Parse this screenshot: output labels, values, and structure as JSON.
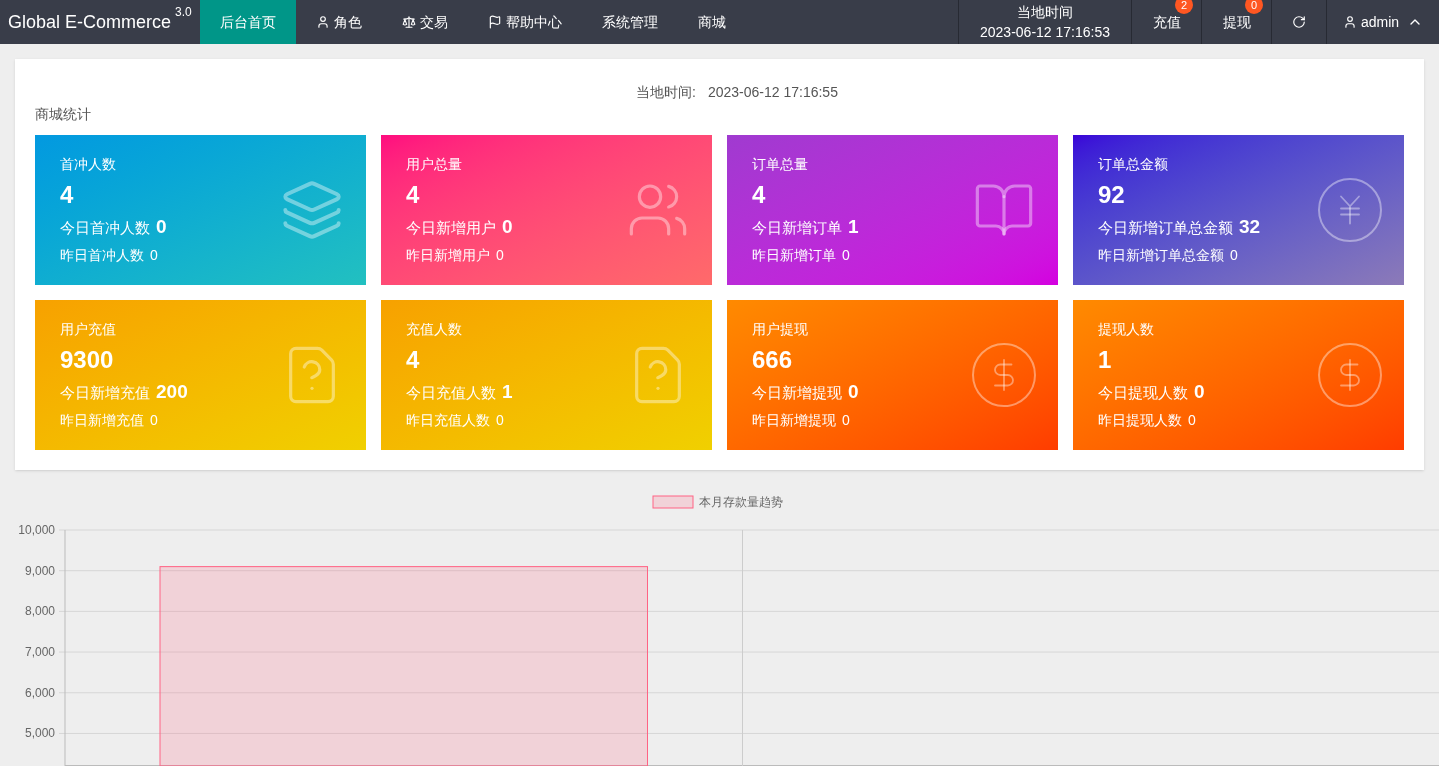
{
  "brand": {
    "name": "Global E-Commerce",
    "version": "3.0"
  },
  "nav": [
    {
      "label": "后台首页",
      "selected": true
    },
    {
      "label": "角色",
      "selected": false
    },
    {
      "label": "交易",
      "selected": false
    },
    {
      "label": "帮助中心",
      "selected": false
    },
    {
      "label": "系统管理",
      "selected": false
    },
    {
      "label": "商城",
      "selected": false
    }
  ],
  "header_clock": {
    "label": "当地时间",
    "time": "2023-06-12 17:16:53"
  },
  "header_actions": [
    {
      "label": "充值",
      "badge": "2"
    },
    {
      "label": "提现",
      "badge": "0"
    }
  ],
  "user": {
    "name": "admin"
  },
  "panel": {
    "local_time_label": "当地时间:",
    "local_time": "2023-06-12 17:16:55",
    "title": "商城统计"
  },
  "cards": [
    {
      "title": "首冲人数",
      "value": "4",
      "today_label": "今日首冲人数",
      "today": "0",
      "yesterday_label": "昨日首冲人数",
      "yesterday": "0",
      "color": "#0aa3df"
    },
    {
      "title": "用户总量",
      "value": "4",
      "today_label": "今日新增用户",
      "today": "0",
      "yesterday_label": "昨日新增用户",
      "yesterday": "0",
      "color": "#ff0a86"
    },
    {
      "title": "订单总量",
      "value": "4",
      "today_label": "今日新增订单",
      "today": "1",
      "yesterday_label": "昨日新增订单",
      "yesterday": "0",
      "color": "#b61fd6"
    },
    {
      "title": "订单总金额",
      "value": "92",
      "today_label": "今日新增订单总金额",
      "today": "32",
      "yesterday_label": "昨日新增订单总金额",
      "yesterday": "0",
      "color": "#4a0fd6"
    },
    {
      "title": "用户充值",
      "value": "9300",
      "today_label": "今日新增充值",
      "today": "200",
      "yesterday_label": "昨日新增充值",
      "yesterday": "0",
      "color": "#f5a800"
    },
    {
      "title": "充值人数",
      "value": "4",
      "today_label": "今日充值人数",
      "today": "1",
      "yesterday_label": "昨日充值人数",
      "yesterday": "0",
      "color": "#f5a800"
    },
    {
      "title": "用户提现",
      "value": "666",
      "today_label": "今日新增提现",
      "today": "0",
      "yesterday_label": "昨日新增提现",
      "yesterday": "0",
      "color": "#ff5a0a"
    },
    {
      "title": "提现人数",
      "value": "1",
      "today_label": "今日提现人数",
      "today": "0",
      "yesterday_label": "昨日提现人数",
      "yesterday": "0",
      "color": "#ff5a0a"
    }
  ],
  "chart": {
    "chart_data": {
      "type": "bar",
      "grid": true,
      "ylim": [
        4200,
        10000
      ],
      "yticks": [
        {
          "value": 5000,
          "label": "5,000"
        },
        {
          "value": 6000,
          "label": "6,000"
        },
        {
          "value": 7000,
          "label": "7,000"
        },
        {
          "value": 8000,
          "label": "8,000"
        },
        {
          "value": 9000,
          "label": "9,000"
        },
        {
          "value": 10000,
          "label": "10,000"
        }
      ],
      "series": [
        {
          "name": "本月存款量趋势",
          "color": "#ff6384",
          "values": [
            9100,
            null
          ]
        }
      ]
    }
  }
}
